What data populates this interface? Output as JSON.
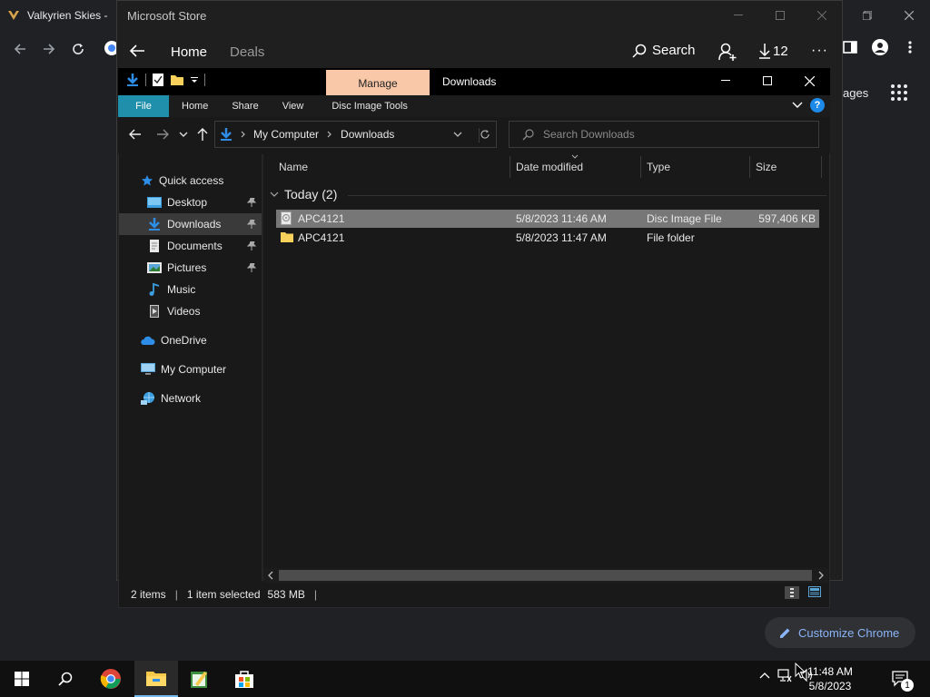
{
  "chrome": {
    "tab_title": "Valkyrien Skies -",
    "right_text": "ages",
    "customize_label": "Customize Chrome"
  },
  "store": {
    "title": "Microsoft Store",
    "nav_home": "Home",
    "nav_deals": "Deals",
    "search_label": "Search",
    "downloads_count": "12",
    "more_label": "···"
  },
  "explorer": {
    "title": "Downloads",
    "manage_tab": "Manage",
    "ribbon_tabs": [
      "File",
      "Home",
      "Share",
      "View",
      "Disc Image Tools"
    ],
    "address": {
      "crumbs": [
        "My Computer",
        "Downloads"
      ]
    },
    "search_placeholder": "Search Downloads",
    "nav_items": [
      {
        "label": "Quick access"
      },
      {
        "label": "Desktop"
      },
      {
        "label": "Downloads"
      },
      {
        "label": "Documents"
      },
      {
        "label": "Pictures"
      },
      {
        "label": "Music"
      },
      {
        "label": "Videos"
      },
      {
        "label": "OneDrive"
      },
      {
        "label": "My Computer"
      },
      {
        "label": "Network"
      }
    ],
    "columns": [
      "Name",
      "Date modified",
      "Type",
      "Size"
    ],
    "group_label": "Today (2)",
    "files": [
      {
        "name": "APC4121",
        "date": "5/8/2023 11:46 AM",
        "type": "Disc Image File",
        "size": "597,406 KB"
      },
      {
        "name": "APC4121",
        "date": "5/8/2023 11:47 AM",
        "type": "File folder",
        "size": ""
      }
    ],
    "status": {
      "items": "2 items",
      "selected": "1 item selected",
      "size": "583 MB"
    }
  },
  "taskbar": {
    "time": "11:48 AM",
    "date": "5/8/2023",
    "notification_count": "1"
  },
  "colors": {
    "manage_accent": "#f9c8a9",
    "file_tab": "#1f8fab",
    "selection": "#777777",
    "chrome_link": "#8ab4f8"
  }
}
